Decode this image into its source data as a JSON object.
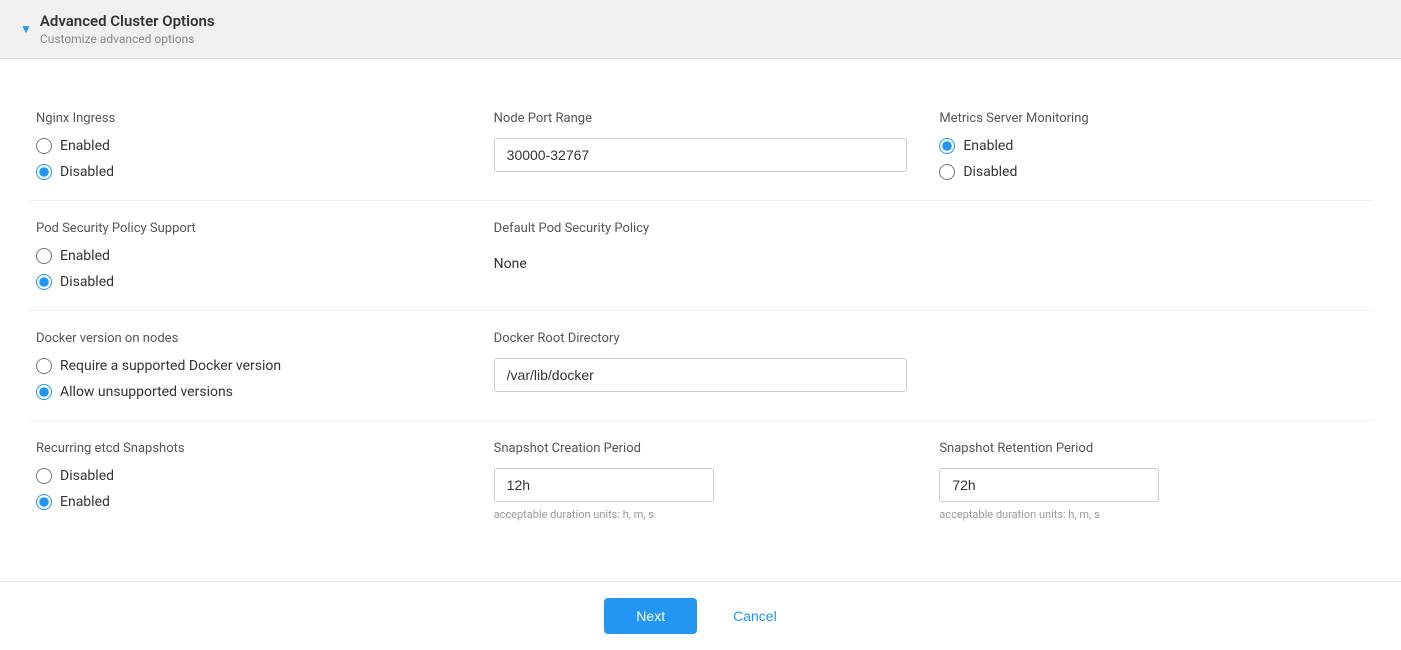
{
  "header": {
    "title": "Advanced Cluster Options",
    "subtitle": "Customize advanced options",
    "triangle_icon": "▼"
  },
  "rows": [
    {
      "left": {
        "label": "Nginx Ingress",
        "type": "radio",
        "options": [
          {
            "label": "Enabled",
            "value": "enabled",
            "checked": false
          },
          {
            "label": "Disabled",
            "value": "disabled",
            "checked": true
          }
        ]
      },
      "middle": {
        "label": "Node Port Range",
        "type": "input",
        "value": "30000-32767"
      },
      "right": {
        "label": "Metrics Server Monitoring",
        "type": "radio",
        "options": [
          {
            "label": "Enabled",
            "value": "enabled",
            "checked": true
          },
          {
            "label": "Disabled",
            "value": "disabled",
            "checked": false
          }
        ]
      }
    },
    {
      "left": {
        "label": "Pod Security Policy Support",
        "type": "radio",
        "options": [
          {
            "label": "Enabled",
            "value": "enabled",
            "checked": false
          },
          {
            "label": "Disabled",
            "value": "disabled",
            "checked": true
          }
        ]
      },
      "middle": {
        "label": "Default Pod Security Policy",
        "type": "static",
        "value": "None"
      },
      "right": null
    },
    {
      "left": {
        "label": "Docker version on nodes",
        "type": "radio",
        "options": [
          {
            "label": "Require a supported Docker version",
            "value": "require",
            "checked": false
          },
          {
            "label": "Allow unsupported versions",
            "value": "allow",
            "checked": true
          }
        ]
      },
      "middle": {
        "label": "Docker Root Directory",
        "type": "input",
        "value": "/var/lib/docker"
      },
      "right": null
    },
    {
      "left": {
        "label": "Recurring etcd Snapshots",
        "type": "radio",
        "options": [
          {
            "label": "Disabled",
            "value": "disabled",
            "checked": false
          },
          {
            "label": "Enabled",
            "value": "enabled",
            "checked": true
          }
        ]
      },
      "middle": {
        "label": "Snapshot Creation Period",
        "type": "input",
        "value": "12h",
        "hint": "acceptable duration units: h, m, s"
      },
      "right": {
        "label": "Snapshot Retention Period",
        "type": "input",
        "value": "72h",
        "hint": "acceptable duration units: h, m, s"
      }
    }
  ],
  "footer": {
    "next_label": "Next",
    "cancel_label": "Cancel"
  }
}
